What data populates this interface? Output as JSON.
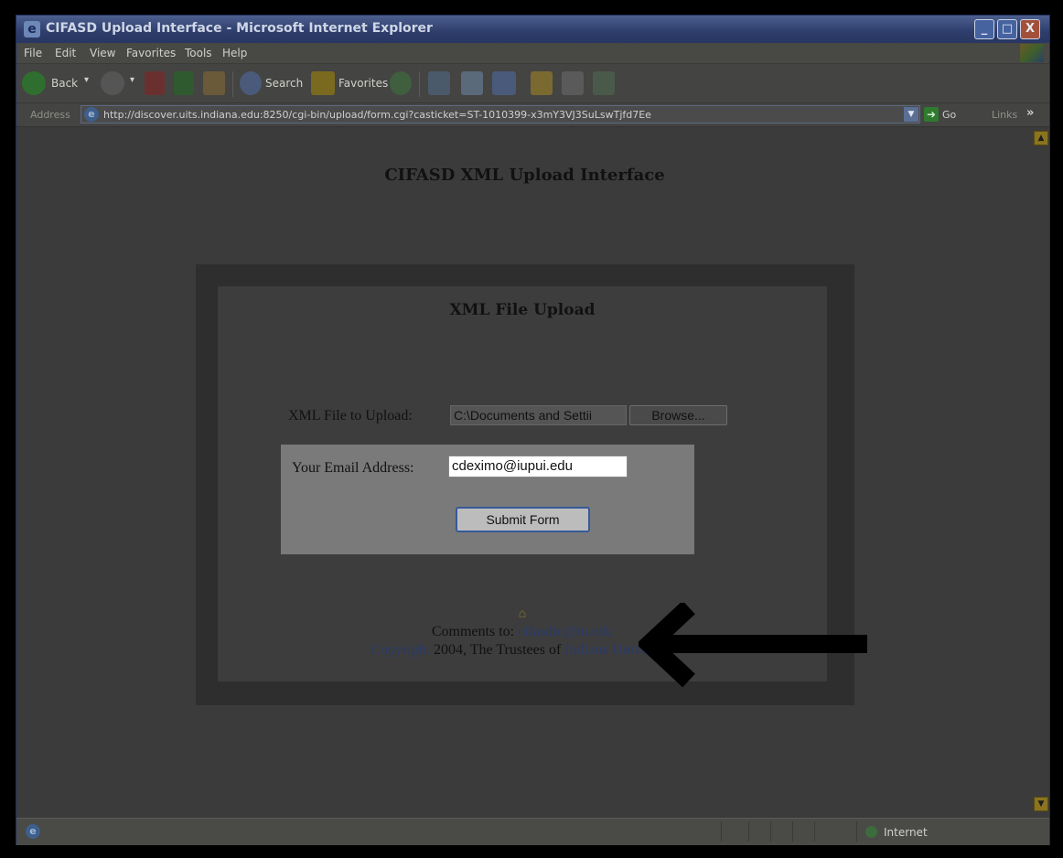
{
  "window": {
    "title": "CIFASD Upload Interface - Microsoft Internet Explorer",
    "buttons": {
      "minimize": "_",
      "maximize": "□",
      "close": "X"
    }
  },
  "menu": [
    "File",
    "Edit",
    "View",
    "Favorites",
    "Tools",
    "Help"
  ],
  "toolbar": {
    "back_label": "Back",
    "search_label": "Search",
    "favorites_label": "Favorites"
  },
  "address": {
    "label": "Address",
    "url": "http://discover.uits.indiana.edu:8250/cgi-bin/upload/form.cgi?casticket=ST-1010399-x3mY3VJ3SuLswTjfd7Ee",
    "go_label": "Go",
    "links_label": "Links"
  },
  "page": {
    "title": "CIFASD XML Upload Interface",
    "section_title": "XML File Upload",
    "file_label": "XML File to Upload:",
    "file_value": "C:\\Documents and Settii",
    "browse_label": "Browse...",
    "email_label": "Your Email Address:",
    "email_value": "cdeximo@iupui.edu",
    "submit_label": "Submit Form",
    "footer": {
      "comments_prefix": "Comments to:",
      "comments_email": "cifasdic@iu.edu",
      "copyright_link": "Copyright",
      "copyright_text": "2004, The Trustees of",
      "university_link": "Indiana University"
    }
  },
  "status": {
    "zone": "Internet"
  },
  "colors": {
    "arrow": "#000000",
    "link": "#2a3a6a",
    "submit_border": "#355a9a"
  }
}
